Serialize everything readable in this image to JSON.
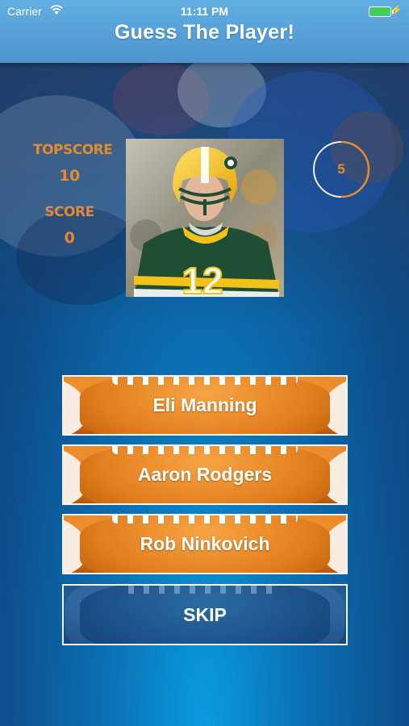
{
  "status_bar": {
    "carrier": "Carrier",
    "time": "11:11 PM"
  },
  "nav": {
    "title": "Guess The Player!"
  },
  "scores": {
    "top_label": "TOPSCORE",
    "top_value": "10",
    "score_label": "SCORE",
    "score_value": "0"
  },
  "timer": {
    "value": "5"
  },
  "player_photo": {
    "jersey_number": "12"
  },
  "answers": [
    {
      "label": "Eli Manning"
    },
    {
      "label": "Aaron Rodgers"
    },
    {
      "label": "Rob Ninkovich"
    }
  ],
  "skip": {
    "label": "SKIP"
  },
  "colors": {
    "accent": "#e58a2f",
    "nav": "#5aa6dd",
    "jersey_green": "#1f4e34",
    "helmet_gold": "#f3c21a"
  }
}
